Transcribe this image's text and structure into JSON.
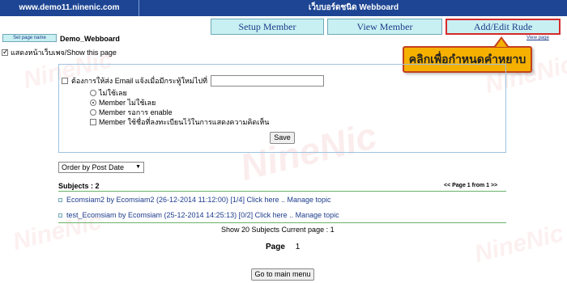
{
  "header": {
    "site": "www.demo11.ninenic.com",
    "title": "เว็บบอร์ดชนิด Webboard"
  },
  "nav": [
    {
      "label": "Setup Member"
    },
    {
      "label": "View Member"
    },
    {
      "label": "Add/Edit Rude"
    }
  ],
  "view_page_link": "View page",
  "tooltip": "คลิกเพื่อกำหนดคำหยาบ",
  "toolbar": {
    "set_page_button": "Set page name",
    "board_name": "Demo_Webboard"
  },
  "show_page": {
    "label": "แสดงหน้าเว็บเพจ/Show this page",
    "checked": true
  },
  "settings": {
    "email_label": "ต้องการให้ส่ง Email แจ้งเมื่อมีกระทู้ใหม่ไปที่",
    "email_value": "",
    "options": [
      {
        "type": "radio",
        "label": "ไม่ใช้เลย",
        "checked": false
      },
      {
        "type": "radio",
        "label": "Member ไม่ใช้เลย",
        "checked": true
      },
      {
        "type": "radio",
        "label": "Member รอการ enable",
        "checked": false
      },
      {
        "type": "checkbox",
        "label": "Member ใช้ชื่อที่ลงทะเบียนไว้ในการแสดงความคิดเห็น",
        "checked": false
      }
    ],
    "save_label": "Save"
  },
  "order": {
    "selected": "Order by Post Date"
  },
  "subjects": {
    "label": "Subjects : 2",
    "pager": "<< Page 1 from 1 >>"
  },
  "topics": [
    {
      "text": "Ecomsiam2 by Ecomsiam2 (26-12-2014 11:12:00) [1/4] Click here .. Manage topic"
    },
    {
      "text": "test_Ecomsiam by Ecomsiam (25-12-2014 14:25:13) [0/2] Click here .. Manage topic"
    }
  ],
  "footer": {
    "show_count": "Show 20 Subjects Current page : 1",
    "page_label": "Page",
    "page_number": "1",
    "main_menu_label": "Go to main menu"
  },
  "watermark": {
    "brand": "NineNic"
  },
  "colors": {
    "header_bg": "#1d4593",
    "nav_bg": "#c8f0f2",
    "selected_border": "#d62a2a",
    "tooltip_bg": "#f5b000",
    "link": "#1d3c8c"
  }
}
